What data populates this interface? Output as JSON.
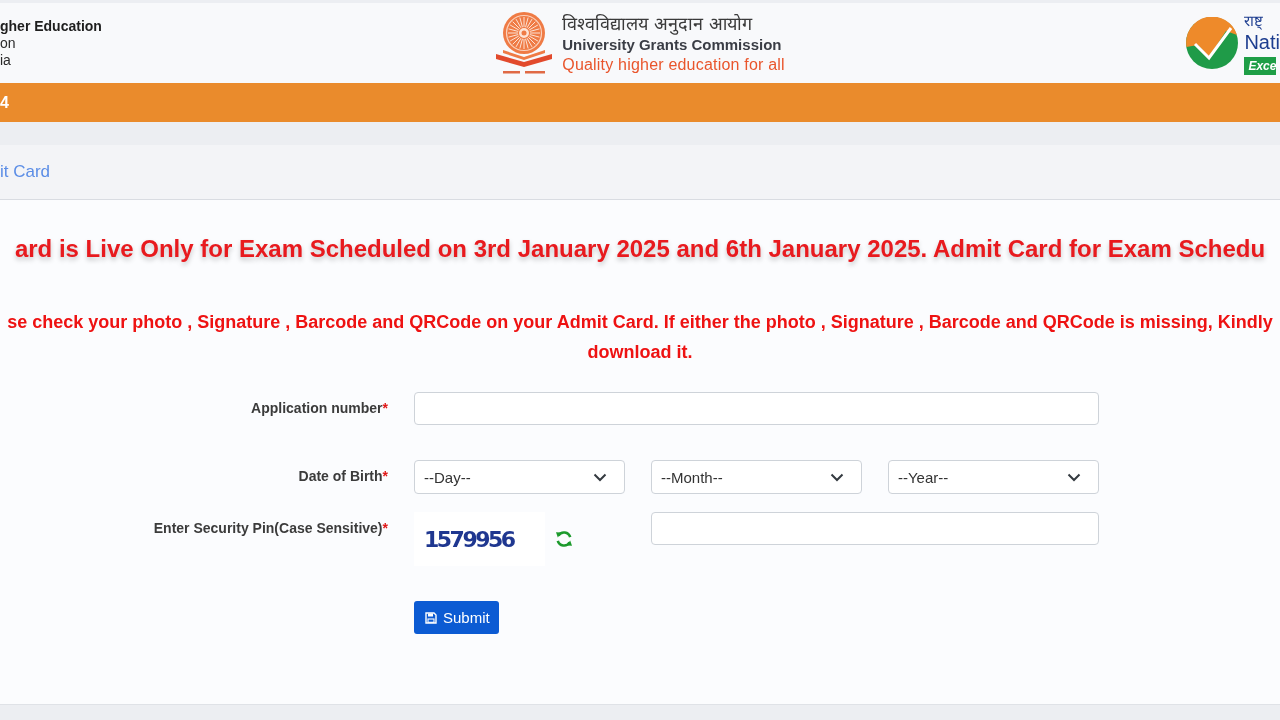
{
  "header": {
    "left_text": {
      "title": "gher Education",
      "lines": [
        "on",
        "ia"
      ]
    },
    "center_logo": {
      "hindi_name": "विश्वविद्यालय अनुदान आयोग",
      "name": "University Grants Commission",
      "tagline": "Quality higher education for all"
    },
    "right_logo": {
      "hindi_text": "राष्ट्",
      "name": "Nati",
      "badge": "Exce"
    }
  },
  "banner": {
    "text": "4"
  },
  "card": {
    "title": "it Card",
    "notice": "ard is Live Only for Exam Scheduled on 3rd January 2025 and 6th January 2025. Admit Card for Exam Schedu",
    "instruction": "se check your photo , Signature , Barcode and QRCode on your Admit Card. If either the photo , Signature , Barcode and QRCode is missing, Kindly download it.",
    "form": {
      "rows": [
        {
          "kind": "text",
          "label": "Application number",
          "required_mark": "*"
        },
        {
          "kind": "select",
          "label": "Date of Birth",
          "required_mark": "*",
          "selects": [
            {
              "value": "--Day--"
            },
            {
              "value": "--Month--"
            },
            {
              "value": "--Year--"
            }
          ]
        },
        {
          "kind": "captcha",
          "label": "Enter Security Pin(Case Sensitive)",
          "required_mark": "*",
          "captcha_text": "1579956"
        }
      ],
      "submit": {
        "label": "Submit"
      }
    }
  }
}
